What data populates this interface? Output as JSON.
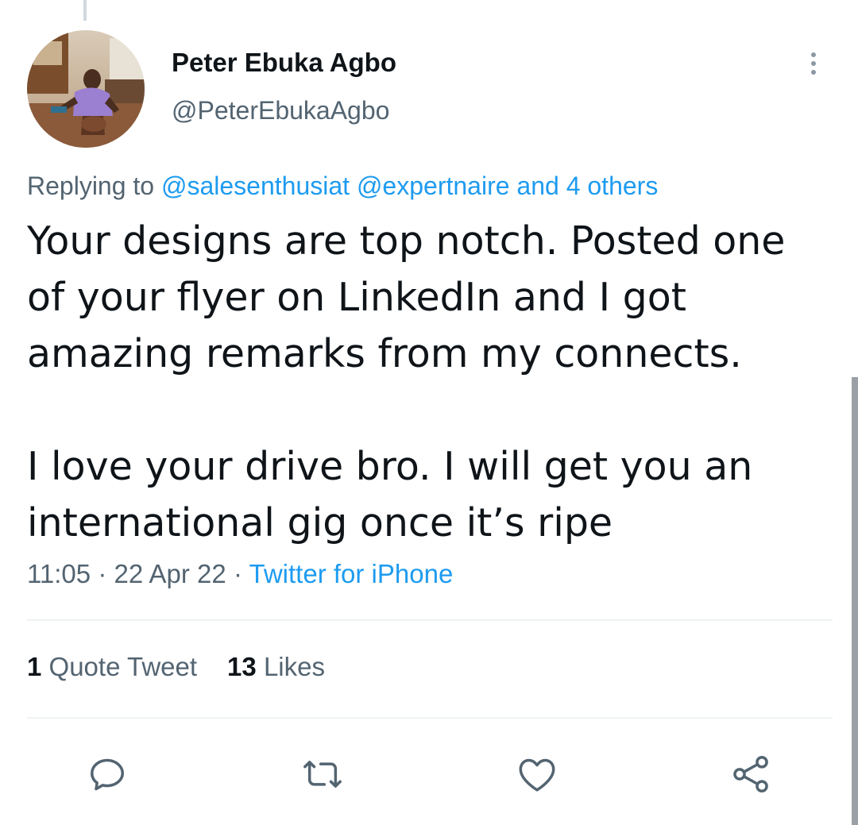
{
  "tweet": {
    "author_name": "Peter Ebuka Agbo",
    "author_handle": "@PeterEbukaAgbo",
    "replying_prefix": "Replying to",
    "replying_to": "@salesenthusiat @expertnaire and 4 others",
    "paragraph_1": "Your designs are top notch. Posted one of your flyer on LinkedIn and I got amazing remarks from my connects.",
    "paragraph_2": "I love your drive bro. I will get you an international gig once it’s ripe",
    "time": "11:05",
    "date": "22 Apr 22",
    "separator": "·",
    "source": "Twitter for iPhone"
  },
  "stats": {
    "quote_count": "1",
    "quote_label": "Quote Tweet",
    "like_count": "13",
    "like_label": "Likes"
  },
  "icons": {
    "more": "more-vertical-icon",
    "reply": "reply-icon",
    "retweet": "retweet-icon",
    "like": "heart-icon",
    "share": "share-icon"
  },
  "colors": {
    "link": "#1d9bf0",
    "secondary_text": "#536471",
    "primary_text": "#0f1419",
    "divider": "#eff3f4"
  }
}
